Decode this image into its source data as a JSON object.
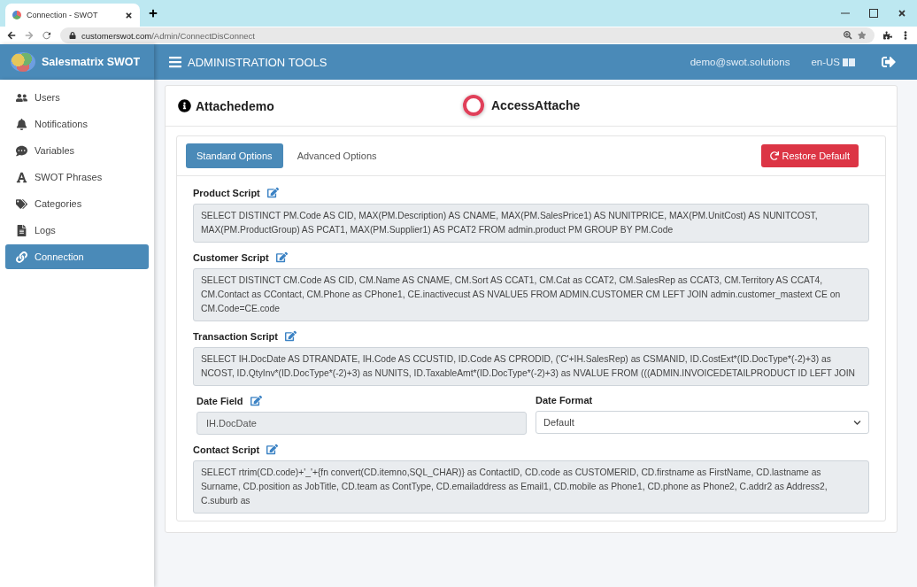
{
  "browser": {
    "tab_title": "Connection - SWOT",
    "url_host": "customerswot.com",
    "url_path": "/Admin/ConnectDisConnect"
  },
  "header": {
    "brand": "Salesmatrix SWOT",
    "title": "ADMINISTRATION TOOLS",
    "user": "demo@swot.solutions",
    "language": "en-US"
  },
  "sidebar": {
    "items": [
      {
        "label": "Users",
        "selected": false
      },
      {
        "label": "Notifications",
        "selected": false
      },
      {
        "label": "Variables",
        "selected": false
      },
      {
        "label": "SWOT Phrases",
        "selected": false
      },
      {
        "label": "Categories",
        "selected": false
      },
      {
        "label": "Logs",
        "selected": false
      },
      {
        "label": "Connection",
        "selected": true
      }
    ]
  },
  "card": {
    "title": "Attachedemo",
    "connection": "AccessAttache",
    "connected": true
  },
  "tabs": [
    {
      "label": "Standard Options",
      "selected": true
    },
    {
      "label": "Advanced Options",
      "selected": false
    }
  ],
  "restore_button": "Restore Default",
  "scripts": [
    {
      "label": "Product Script",
      "value": "SELECT DISTINCT PM.Code AS CID, MAX(PM.Description) AS CNAME, MAX(PM.SalesPrice1) AS NUNITPRICE, MAX(PM.UnitCost) AS NUNITCOST, MAX(PM.ProductGroup) AS PCAT1, MAX(PM.Supplier1) AS PCAT2 FROM admin.product PM GROUP BY PM.Code"
    },
    {
      "label": "Customer Script",
      "value": "SELECT DISTINCT CM.Code AS CID, CM.Name AS CNAME, CM.Sort AS CCAT1, CM.Cat as CCAT2, CM.SalesRep as CCAT3, CM.Territory AS CCAT4, CM.Contact as CContact, CM.Phone as CPhone1, CE.inactivecust AS NVALUE5 FROM ADMIN.CUSTOMER CM LEFT JOIN admin.customer_mastext CE on CM.Code=CE.code"
    },
    {
      "label": "Transaction Script",
      "value": "SELECT IH.DocDate AS DTRANDATE, IH.Code AS CCUSTID, ID.Code AS CPRODID, ('C'+IH.SalesRep) as CSMANID, ID.CostExt*(ID.DocType*(-2)+3) as NCOST, ID.QtyInv*(ID.DocType*(-2)+3) as NUNITS, ID.TaxableAmt*(ID.DocType*(-2)+3) as NVALUE FROM (((ADMIN.INVOICEDETAILPRODUCT ID LEFT JOIN"
    }
  ],
  "date_field": {
    "label": "Date Field",
    "value": "IH.DocDate"
  },
  "date_format": {
    "label": "Date Format",
    "value": "Default"
  },
  "contact_script": {
    "label": "Contact Script",
    "value": "SELECT rtrim(CD.code)+'_'+{fn convert(CD.itemno,SQL_CHAR)} as ContactID, CD.code as CUSTOMERID, CD.firstname as FirstName, CD.lastname as Surname, CD.position as JobTitle, CD.team as ContType, CD.emailaddress as Email1, CD.mobile as Phone1, CD.phone as Phone2, C.addr2 as Address2, C.suburb as"
  }
}
